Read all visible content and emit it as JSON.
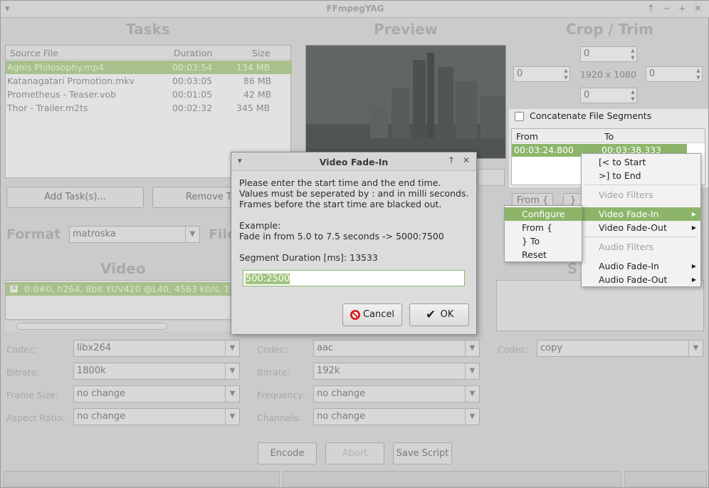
{
  "window": {
    "title": "FFmpegYAG"
  },
  "sections": {
    "tasks": "Tasks",
    "preview": "Preview",
    "crop": "Crop / Trim",
    "format": "Format",
    "file": "File",
    "video": "Video",
    "subs": "S"
  },
  "tasks": {
    "headers": [
      "Source File",
      "Duration",
      "Size"
    ],
    "rows": [
      {
        "file": "Agnis Philosophy.mp4",
        "duration": "00:03:54",
        "size": "134 MB"
      },
      {
        "file": "Katanagatari Promotion.mkv",
        "duration": "00:03:05",
        "size": "86 MB"
      },
      {
        "file": "Prometheus - Teaser.vob",
        "duration": "00:01:05",
        "size": "42 MB"
      },
      {
        "file": "Thor - Trailer.m2ts",
        "duration": "00:02:32",
        "size": "345 MB"
      }
    ],
    "add_label": "Add Task(s)...",
    "remove_label": "Remove Ta"
  },
  "crop": {
    "top": "0",
    "left": "0",
    "right": "0",
    "bottom": "0",
    "resolution": "1920 x 1080"
  },
  "concat": {
    "label": "Concatenate File Segments",
    "checked": false,
    "headers": [
      "From",
      "To"
    ],
    "row": {
      "from": "00:03:24.800",
      "to": "00:03:38.333"
    },
    "from_btn": "From {",
    "to_btn": "}"
  },
  "format": {
    "value": "matroska"
  },
  "video_stream": {
    "text": "0:0#0, h264, 8bit YUV420 @L40, 4563 kb/s, 19"
  },
  "video_settings": [
    {
      "label": "Codec:",
      "value": "libx264"
    },
    {
      "label": "Bitrate:",
      "value": "1800k"
    },
    {
      "label": "Frame Size:",
      "value": "no change"
    },
    {
      "label": "Aspect Ratio:",
      "value": "no change"
    }
  ],
  "audio_settings": [
    {
      "label": "Codec:",
      "value": "aac"
    },
    {
      "label": "Bitrate:",
      "value": "192k"
    },
    {
      "label": "Frequency:",
      "value": "no change"
    },
    {
      "label": "Channels:",
      "value": "no change"
    }
  ],
  "subtitle_settings": {
    "label": "Codec:",
    "value": "copy"
  },
  "footer": {
    "encode": "Encode",
    "abort": "Abort",
    "save": "Save Script"
  },
  "dialog": {
    "title": "Video Fade-In",
    "line1": "Please enter the start time and the end time.",
    "line2": "Values must be seperated by : and in milli seconds.",
    "line3": "Frames before the start time are blacked out.",
    "example_label": "Example:",
    "example_text": "Fade in from 5.0 to 7.5 seconds -> 5000:7500",
    "duration_label": "Segment Duration [ms]: 13533",
    "input_value": "500:2500",
    "cancel": "Cancel",
    "ok": "OK"
  },
  "context_menu": {
    "to_start": "[< to Start",
    "to_end": ">] to End",
    "video_filters": "Video Filters",
    "video_fade_in": "Video Fade-In",
    "video_fade_out": "Video Fade-Out",
    "audio_filters": "Audio Filters",
    "audio_fade_in": "Audio Fade-In",
    "audio_fade_out": "Audio Fade-Out"
  },
  "submenu": {
    "configure": "Configure",
    "from": "From {",
    "to": "} To",
    "reset": "Reset"
  },
  "colors": {
    "selection": "#8db56a",
    "dim_overlay": "#cbcbcb"
  }
}
